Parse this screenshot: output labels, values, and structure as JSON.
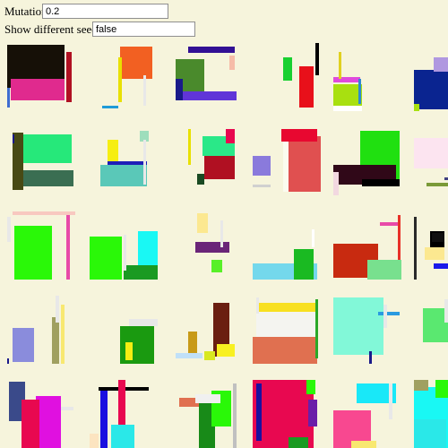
{
  "controls": {
    "mutation_rate_label": "Mutation Rate:",
    "mutation_rate_value": "0.2",
    "seeds_label": "Show different seeds",
    "seeds_value": "false"
  },
  "tiles": [
    [
      [
        [
          0,
          2,
          64,
          48,
          "#161007"
        ],
        [
          4,
          40,
          60,
          24,
          "#e02a8e"
        ],
        [
          66,
          10,
          6,
          56,
          "#b01022"
        ],
        [
          0,
          50,
          3,
          22,
          "#3f6cd0"
        ]
      ],
      [
        [
          34,
          4,
          36,
          36,
          "#f26022"
        ],
        [
          32,
          16,
          4,
          50,
          "#e8e000"
        ],
        [
          14,
          70,
          18,
          3,
          "#1f9bd8"
        ],
        [
          60,
          36,
          3,
          34,
          "#e8e8e8"
        ]
      ],
      [
        [
          14,
          4,
          52,
          7,
          "#321094"
        ],
        [
          0,
          18,
          32,
          38,
          "#4a8a2c"
        ],
        [
          0,
          54,
          68,
          10,
          "#6035d8"
        ],
        [
          60,
          14,
          6,
          16,
          "#f6bca8"
        ],
        [
          0,
          40,
          8,
          24,
          "#1a1a8a"
        ]
      ],
      [
        [
          34,
          16,
          10,
          26,
          "#18d030"
        ],
        [
          52,
          26,
          16,
          46,
          "#e8101a"
        ],
        [
          70,
          0,
          4,
          36,
          "#000000"
        ]
      ],
      [
        [
          0,
          48,
          32,
          36,
          "#ffffff"
        ],
        [
          0,
          46,
          32,
          24,
          "#a8e010"
        ],
        [
          -4,
          38,
          34,
          6,
          "#e04adc"
        ],
        [
          6,
          10,
          3,
          30,
          "#e0d020"
        ],
        [
          28,
          40,
          3,
          28,
          "#2c8ad0"
        ]
      ],
      [
        [
          0,
          30,
          40,
          44,
          "#0a2490"
        ],
        [
          22,
          16,
          30,
          16,
          "#b098e0"
        ],
        [
          0,
          68,
          6,
          8,
          "#a8e010"
        ]
      ]
    ],
    [
      [
        [
          16,
          6,
          56,
          32,
          "#26e87a"
        ],
        [
          6,
          4,
          12,
          64,
          "#484a14"
        ],
        [
          18,
          46,
          56,
          18,
          "#3a6e52"
        ],
        [
          6,
          6,
          2,
          10,
          "#1a1a8a"
        ]
      ],
      [
        [
          20,
          12,
          12,
          30,
          "#f6ee12"
        ],
        [
          20,
          36,
          44,
          24,
          "#1e1eb8"
        ],
        [
          12,
          40,
          52,
          24,
          "#5ac8b8"
        ],
        [
          56,
          2,
          10,
          12,
          "#9edebc"
        ],
        [
          60,
          12,
          3,
          50,
          "#e8e8e8"
        ]
      ],
      [
        [
          14,
          0,
          3,
          40,
          "#e8e000"
        ],
        [
          32,
          20,
          34,
          36,
          "#b01022"
        ],
        [
          30,
          8,
          36,
          22,
          "#2ae888"
        ],
        [
          56,
          0,
          10,
          16,
          "#e80850"
        ],
        [
          24,
          50,
          8,
          12,
          "#1a4a22"
        ]
      ],
      [
        [
          34,
          0,
          36,
          70,
          "#fbfbef"
        ],
        [
          40,
          8,
          38,
          62,
          "#e05050"
        ],
        [
          32,
          0,
          40,
          14,
          "#e80830"
        ],
        [
          0,
          30,
          20,
          22,
          "#8a7adc"
        ],
        [
          0,
          62,
          20,
          3,
          "#d0d0d0"
        ]
      ],
      [
        [
          30,
          2,
          44,
          56,
          "#20e010"
        ],
        [
          0,
          40,
          70,
          22,
          "#300818"
        ],
        [
          32,
          56,
          42,
          8,
          "#000000"
        ],
        [
          0,
          48,
          6,
          26,
          "#f2d8e0"
        ]
      ],
      [
        [
          0,
          10,
          40,
          34,
          "#fce4f0"
        ],
        [
          14,
          60,
          40,
          4,
          "#7a9a38"
        ],
        [
          34,
          54,
          12,
          3,
          "#404080"
        ]
      ]
    ],
    [
      [
        [
          8,
          16,
          42,
          60,
          "#2af808"
        ],
        [
          6,
          0,
          70,
          4,
          "#f8c8c0"
        ],
        [
          66,
          4,
          4,
          72,
          "#e84aa8"
        ],
        [
          0,
          6,
          4,
          28,
          "#e8e8e8"
        ]
      ],
      [
        [
          0,
          28,
          36,
          48,
          "#2af808"
        ],
        [
          54,
          22,
          22,
          46,
          "#19f8f4"
        ],
        [
          38,
          60,
          40,
          16,
          "#1a9a22"
        ],
        [
          38,
          26,
          3,
          40,
          "#e8e8e8"
        ]
      ],
      [
        [
          24,
          2,
          12,
          22,
          "#fce890"
        ],
        [
          22,
          34,
          38,
          12,
          "#6a2478"
        ],
        [
          40,
          54,
          12,
          14,
          "#58f028"
        ],
        [
          50,
          10,
          3,
          30,
          "#e8e8e8"
        ]
      ],
      [
        [
          0,
          58,
          72,
          18,
          "#74d8ec"
        ],
        [
          46,
          42,
          22,
          34,
          "#1aba22"
        ],
        [
          66,
          20,
          3,
          20,
          "#ffffff"
        ]
      ],
      [
        [
          0,
          36,
          50,
          38,
          "#c82a10"
        ],
        [
          38,
          54,
          40,
          22,
          "#78e08e"
        ],
        [
          52,
          12,
          20,
          4,
          "#e84aa8"
        ],
        [
          72,
          4,
          3,
          50,
          "#e83028"
        ]
      ],
      [
        [
          12,
          40,
          22,
          14,
          "#fce890"
        ],
        [
          18,
          22,
          16,
          18,
          "#000000"
        ],
        [
          20,
          24,
          14,
          10,
          "#101010"
        ],
        [
          22,
          58,
          22,
          6,
          "#1a1aea"
        ],
        [
          0,
          6,
          3,
          70,
          "#2a2a2a"
        ]
      ]
    ],
    [
      [
        [
          6,
          36,
          24,
          38,
          "#8a8cdc"
        ],
        [
          50,
          24,
          8,
          52,
          "#a0a060"
        ],
        [
          54,
          0,
          4,
          30,
          "#e8e8e8"
        ],
        [
          -2,
          70,
          4,
          6,
          "#1a1a8a"
        ],
        [
          60,
          10,
          4,
          66,
          "#f8e870"
        ]
      ],
      [
        [
          34,
          34,
          38,
          42,
          "#1a9a10"
        ],
        [
          44,
          26,
          34,
          8,
          "#e8e8e8"
        ],
        [
          40,
          52,
          8,
          20,
          "#f6ee12"
        ]
      ],
      [
        [
          14,
          40,
          10,
          24,
          "#c89a18"
        ],
        [
          42,
          8,
          18,
          60,
          "#6a1e10"
        ],
        [
          0,
          64,
          30,
          6,
          "#c0e0f8"
        ],
        [
          32,
          62,
          12,
          10,
          "#d8e820"
        ],
        [
          46,
          54,
          20,
          14,
          "#f8f020"
        ]
      ],
      [
        [
          6,
          8,
          66,
          10,
          "#f8e020"
        ],
        [
          4,
          18,
          66,
          40,
          "#f4f4f0"
        ],
        [
          0,
          46,
          72,
          30,
          "#e07050"
        ],
        [
          70,
          4,
          3,
          66,
          "#2aa828"
        ],
        [
          4,
          2,
          3,
          18,
          "#e8e8e8"
        ]
      ],
      [
        [
          0,
          2,
          56,
          64,
          "#82f8d8"
        ],
        [
          50,
          18,
          24,
          4,
          "#2a9ae0"
        ],
        [
          56,
          10,
          4,
          26,
          "#e8e8e8"
        ],
        [
          40,
          62,
          3,
          14,
          "#1a1a8a"
        ]
      ],
      [
        [
          10,
          14,
          52,
          38,
          "#5ae870"
        ],
        [
          34,
          4,
          4,
          26,
          "#e8e8e8"
        ]
      ]
    ],
    [
      [
        [
          2,
          2,
          18,
          44,
          "#3a4a8a"
        ],
        [
          32,
          18,
          28,
          58,
          "#e010e0"
        ],
        [
          16,
          22,
          20,
          54,
          "#e80850"
        ],
        [
          60,
          30,
          14,
          4,
          "#e8e8e8"
        ]
      ],
      [
        [
          10,
          8,
          56,
          4,
          "#000000"
        ],
        [
          32,
          0,
          8,
          76,
          "#e80850"
        ],
        [
          12,
          12,
          8,
          64,
          "#1a10e0"
        ],
        [
          24,
          50,
          26,
          26,
          "#2ae8e8"
        ],
        [
          0,
          60,
          10,
          16,
          "#fce4c0"
        ]
      ],
      [
        [
          4,
          20,
          56,
          10,
          "#e07050"
        ],
        [
          26,
          24,
          18,
          52,
          "#188a18"
        ],
        [
          40,
          12,
          22,
          40,
          "#2af808"
        ],
        [
          22,
          16,
          28,
          10,
          "#f0f0f0"
        ],
        [
          64,
          4,
          4,
          72,
          "#c0c0c0"
        ]
      ],
      [
        [
          0,
          0,
          68,
          76,
          "#e80850"
        ],
        [
          4,
          4,
          6,
          64,
          "#1a10a0"
        ],
        [
          60,
          0,
          10,
          16,
          "#2af808"
        ],
        [
          62,
          22,
          10,
          30,
          "#6a1ea8"
        ],
        [
          40,
          64,
          22,
          12,
          "#1a9a22"
        ]
      ],
      [
        [
          0,
          34,
          42,
          42,
          "#f84890"
        ],
        [
          26,
          4,
          44,
          22,
          "#19e8f8"
        ],
        [
          20,
          68,
          28,
          8,
          "#f8e870"
        ],
        [
          62,
          4,
          4,
          40,
          "#e8e8e8"
        ]
      ],
      [
        [
          0,
          8,
          44,
          68,
          "#19f8f4"
        ],
        [
          24,
          0,
          40,
          20,
          "#2af808"
        ],
        [
          0,
          44,
          36,
          32,
          "#2ae8e8"
        ],
        [
          0,
          0,
          16,
          12,
          "#a0a060"
        ]
      ]
    ]
  ]
}
